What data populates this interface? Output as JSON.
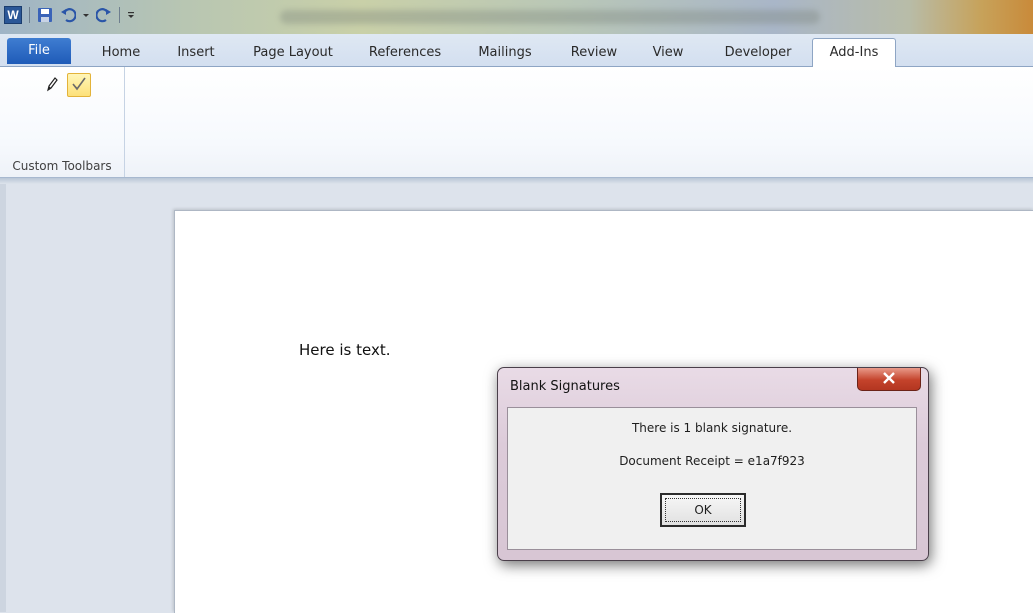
{
  "app": {
    "name": "Microsoft Word",
    "logo_letter": "W"
  },
  "ribbon": {
    "tabs": [
      {
        "label": "File"
      },
      {
        "label": "Home"
      },
      {
        "label": "Insert"
      },
      {
        "label": "Page Layout"
      },
      {
        "label": "References"
      },
      {
        "label": "Mailings"
      },
      {
        "label": "Review"
      },
      {
        "label": "View"
      },
      {
        "label": "Developer"
      },
      {
        "label": "Add-Ins"
      }
    ],
    "active_tab": "Add-Ins",
    "groups": [
      {
        "label": "Custom Toolbars",
        "buttons": [
          "pencil-icon",
          "checkmark-icon"
        ]
      }
    ]
  },
  "document": {
    "body_text": "Here is text."
  },
  "dialog": {
    "title": "Blank Signatures",
    "close_label": "x",
    "message_line1": "There is 1 blank signature.",
    "message_line2": "Document Receipt = e1a7f923",
    "ok_label": "OK"
  },
  "colors": {
    "file_tab": "#1f5bb8",
    "dialog_frame": "#dccbd9",
    "close_button": "#c4432b",
    "highlight_button": "#fde17a"
  }
}
